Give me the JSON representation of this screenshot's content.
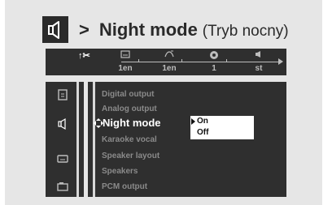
{
  "header": {
    "arrow": ">",
    "title": "Night mode",
    "subtitle": "(Tryb nocny)"
  },
  "status_bar": {
    "items": [
      {
        "icon": "subtitle-icon",
        "value": "1en"
      },
      {
        "icon": "audio-language-icon",
        "value": "1en"
      },
      {
        "icon": "angle-icon",
        "value": "1"
      },
      {
        "icon": "sound-icon",
        "value": "st"
      }
    ]
  },
  "nav": {
    "items": [
      {
        "icon": "general-icon"
      },
      {
        "icon": "speaker-icon"
      },
      {
        "icon": "subtitle-icon"
      },
      {
        "icon": "folder-icon"
      }
    ]
  },
  "menu": {
    "items": [
      {
        "label": "Digital output"
      },
      {
        "label": "Analog output"
      },
      {
        "label": "Night mode"
      },
      {
        "label": "Karaoke vocal"
      },
      {
        "label": "Speaker layout"
      },
      {
        "label": "Speakers"
      },
      {
        "label": "PCM output"
      }
    ],
    "selected_index": 2
  },
  "options": {
    "items": [
      {
        "label": "On"
      },
      {
        "label": "Off"
      }
    ],
    "selected_index": 0
  }
}
